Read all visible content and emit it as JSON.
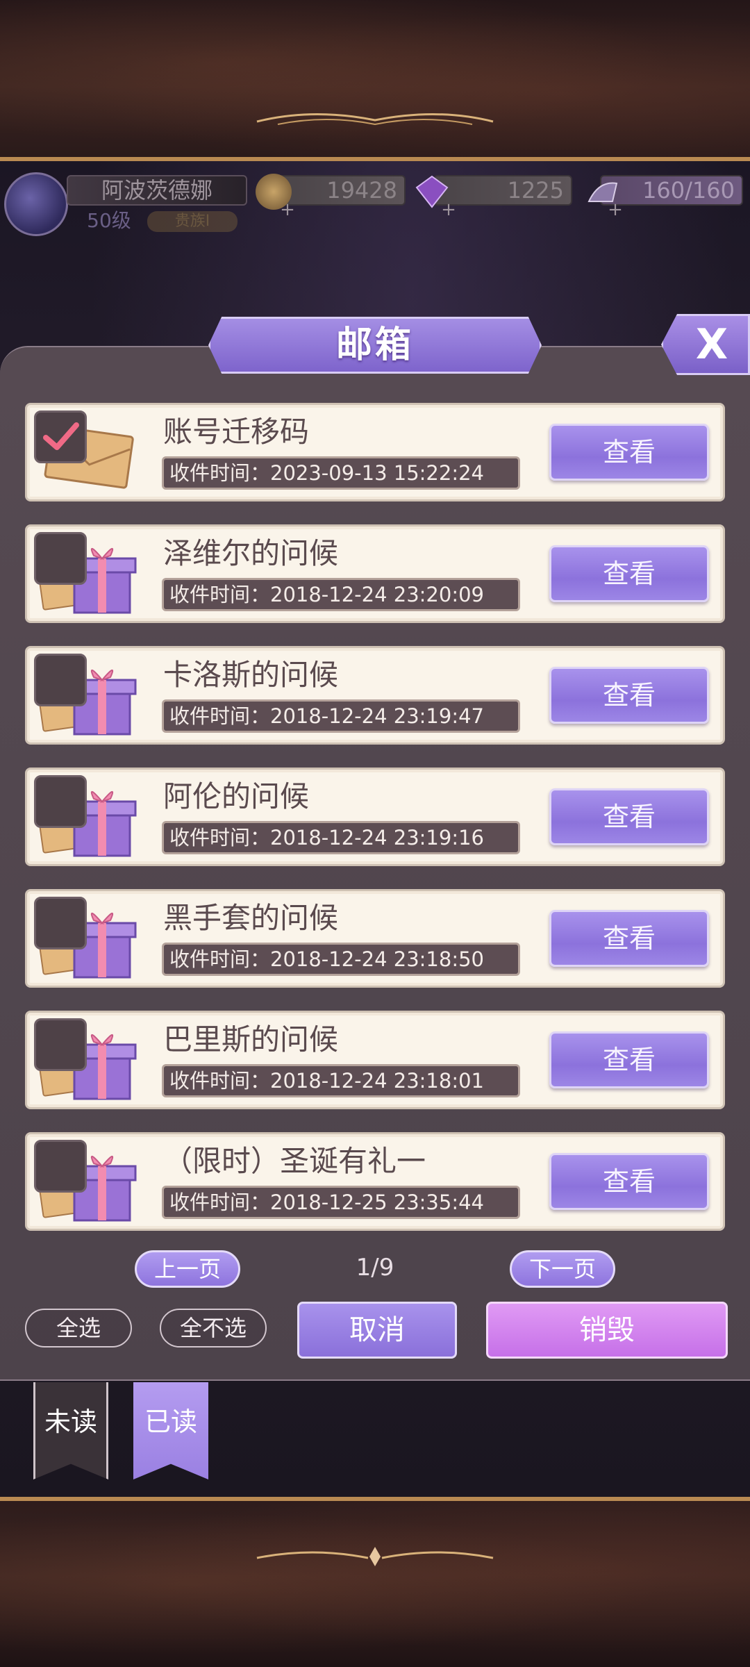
{
  "player": {
    "name": "阿波茨德娜",
    "level": "50级",
    "title": "贵族I"
  },
  "resources": {
    "gold": "19428",
    "diamond": "1225",
    "stamina": "160/160",
    "plus": "+"
  },
  "mailbox": {
    "title": "邮箱",
    "close": "X",
    "view_label": "查看",
    "time_prefix": "收件时间：",
    "items": [
      {
        "title": "账号迁移码",
        "time": "收件时间：2023-09-13 15:22:24",
        "checked": true,
        "type": "envelope"
      },
      {
        "title": "泽维尔的问候",
        "time": "收件时间：2018-12-24 23:20:09",
        "checked": false,
        "type": "gift"
      },
      {
        "title": "卡洛斯的问候",
        "time": "收件时间：2018-12-24 23:19:47",
        "checked": false,
        "type": "gift"
      },
      {
        "title": "阿伦的问候",
        "time": "收件时间：2018-12-24 23:19:16",
        "checked": false,
        "type": "gift"
      },
      {
        "title": "黑手套的问候",
        "time": "收件时间：2018-12-24 23:18:50",
        "checked": false,
        "type": "gift"
      },
      {
        "title": "巴里斯的问候",
        "time": "收件时间：2018-12-24 23:18:01",
        "checked": false,
        "type": "gift"
      },
      {
        "title": "（限时）圣诞有礼一",
        "time": "收件时间：2018-12-25 23:35:44",
        "checked": false,
        "type": "gift"
      }
    ]
  },
  "pager": {
    "prev": "上一页",
    "page": "1/9",
    "next": "下一页"
  },
  "actions": {
    "select_all": "全选",
    "select_none": "全不选",
    "cancel": "取消",
    "destroy": "销毁"
  },
  "tabs": {
    "unread": "未读",
    "read": "已读"
  },
  "colors": {
    "accent_purple": "#9a80e2",
    "destroy_pink": "#c670e8",
    "card_bg": "#faf4ea",
    "gold_trim": "#b98a52"
  }
}
